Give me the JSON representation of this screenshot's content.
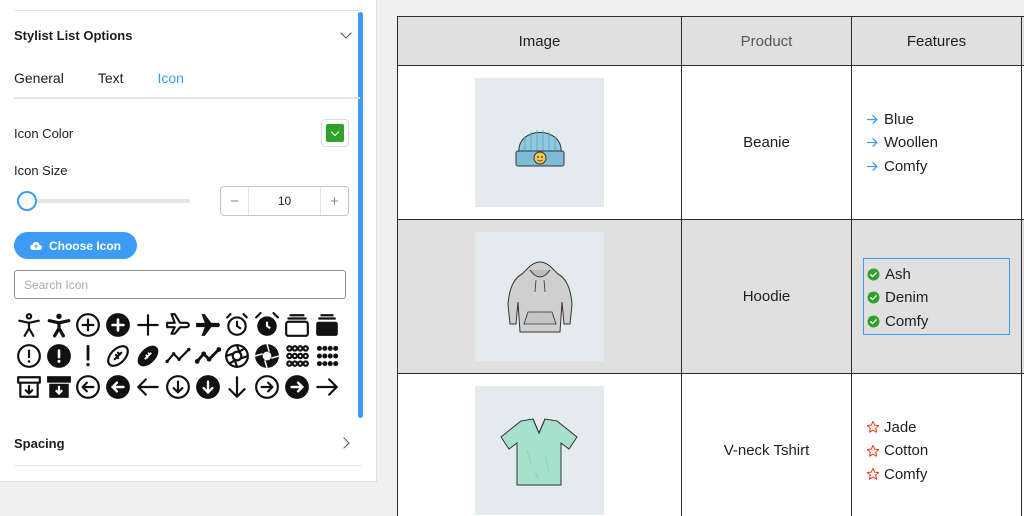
{
  "panel": {
    "section_title": "Stylist List Options",
    "tabs": [
      {
        "label": "General",
        "active": false
      },
      {
        "label": "Text",
        "active": false
      },
      {
        "label": "Icon",
        "active": true
      }
    ],
    "icon_color_label": "Icon Color",
    "icon_color_value": "#2ea12a",
    "icon_size_label": "Icon Size",
    "icon_size_value": "10",
    "icon_size_slider_fraction": 0.04,
    "stepper_minus": "−",
    "stepper_plus": "+",
    "choose_icon_label": "Choose Icon",
    "search_placeholder": "Search Icon",
    "icon_grid": [
      "universal-access-icon",
      "universal-access-solid-icon",
      "circle-plus-icon",
      "circle-plus-solid-icon",
      "plus-icon",
      "plane-outline-icon",
      "plane-solid-icon",
      "alarm-clock-icon",
      "alarm-clock-solid-icon",
      "albums-icon",
      "albums-solid-icon",
      "circle-exclamation-icon",
      "circle-exclamation-solid-icon",
      "exclamation-icon",
      "football-icon",
      "football-solid-icon",
      "line-chart-icon",
      "line-chart-solid-icon",
      "aperture-icon",
      "aperture-solid-icon",
      "dots-grid-icon",
      "dots-grid-solid-icon",
      "archive-box-icon",
      "archive-box-solid-icon",
      "circle-arrow-left-icon",
      "circle-arrow-left-solid-icon",
      "arrow-left-icon",
      "circle-arrow-down-icon",
      "circle-arrow-down-solid-icon",
      "arrow-down-icon",
      "circle-arrow-right-icon",
      "circle-arrow-right-solid-icon",
      "arrow-right-icon"
    ],
    "spacing_title": "Spacing"
  },
  "table": {
    "headers": [
      "Image",
      "Product",
      "Features"
    ],
    "rows": [
      {
        "image": "beanie-image",
        "product": "Beanie",
        "feature_icon": "arrow-right-icon",
        "feature_color": "#3c9cf5",
        "features": [
          "Blue",
          "Woollen",
          "Comfy"
        ]
      },
      {
        "image": "hoodie-image",
        "product": "Hoodie",
        "feature_icon": "circle-check-icon",
        "feature_color": "#2ea12a",
        "features": [
          "Ash",
          "Denim",
          "Comfy"
        ]
      },
      {
        "image": "vneck-tshirt-image",
        "product": "V-neck Tshirt",
        "feature_icon": "star-outline-icon",
        "feature_color": "#e8451e",
        "features": [
          "Jade",
          "Cotton",
          "Comfy"
        ]
      }
    ]
  }
}
